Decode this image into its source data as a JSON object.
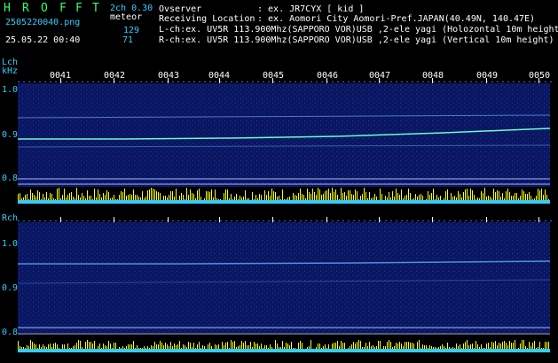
{
  "app": {
    "title_letters": [
      "H",
      "R",
      "O",
      "F",
      "F",
      "T"
    ],
    "mode": "2ch 0.30",
    "filename": "2505220040.png",
    "meteor_label": "meteor",
    "count_l": "129",
    "count_r": "71",
    "datetime": "25.05.22 00:40"
  },
  "info": {
    "observer_label": "Ovserver",
    "observer_value": ": ex. JR7CYX [ kid ]",
    "location_label": "Receiving Location",
    "location_value": ": ex. Aomori City Aomori-Pref.JAPAN(40.49N, 140.47E)",
    "lch_line": "L-ch:ex. UV5R 113.900Mhz(SAPPORO VOR)USB ,2-ele yagi (Holozontal 10m height)",
    "rch_line": "R-ch:ex. UV5R 113.900Mhz(SAPPORO VOR)USB ,2-ele yagi (Vertical 10m height)"
  },
  "lch": {
    "label": "Lch",
    "unit": "kHz",
    "ticks": [
      "1.0",
      "0.9",
      "0.8"
    ]
  },
  "rch": {
    "label": "Rch",
    "ticks": [
      "1.0",
      "0.9",
      "0.8"
    ]
  },
  "time_markers": [
    "0041",
    "0042",
    "0043",
    "0044",
    "0045",
    "0046",
    "0047",
    "0048",
    "0049",
    "0050"
  ],
  "colors": {
    "background": "#000000",
    "spectrogram": "#0a1a66",
    "trace": "#66ffcc",
    "level_yellow": "#ffff00",
    "level_cyan": "#33ccff"
  }
}
